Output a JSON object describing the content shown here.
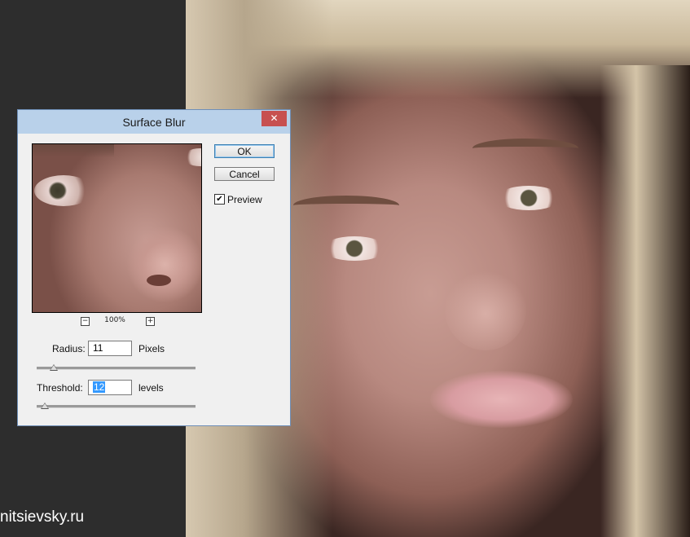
{
  "dialog": {
    "title": "Surface Blur",
    "close_glyph": "✕",
    "ok_label": "OK",
    "cancel_label": "Cancel",
    "preview_label": "Preview",
    "preview_checked": true,
    "zoom": {
      "minus_glyph": "−",
      "plus_glyph": "+",
      "level": "100%"
    },
    "radius": {
      "label": "Radius:",
      "value": "11",
      "unit": "Pixels",
      "slider_fraction": 0.11
    },
    "threshold": {
      "label": "Threshold:",
      "value": "12",
      "unit": "levels",
      "slider_fraction": 0.05
    }
  },
  "watermark": "nitsievsky.ru",
  "colors": {
    "titlebar": "#b9d1ea",
    "close": "#c75050",
    "selection": "#3399ff"
  }
}
